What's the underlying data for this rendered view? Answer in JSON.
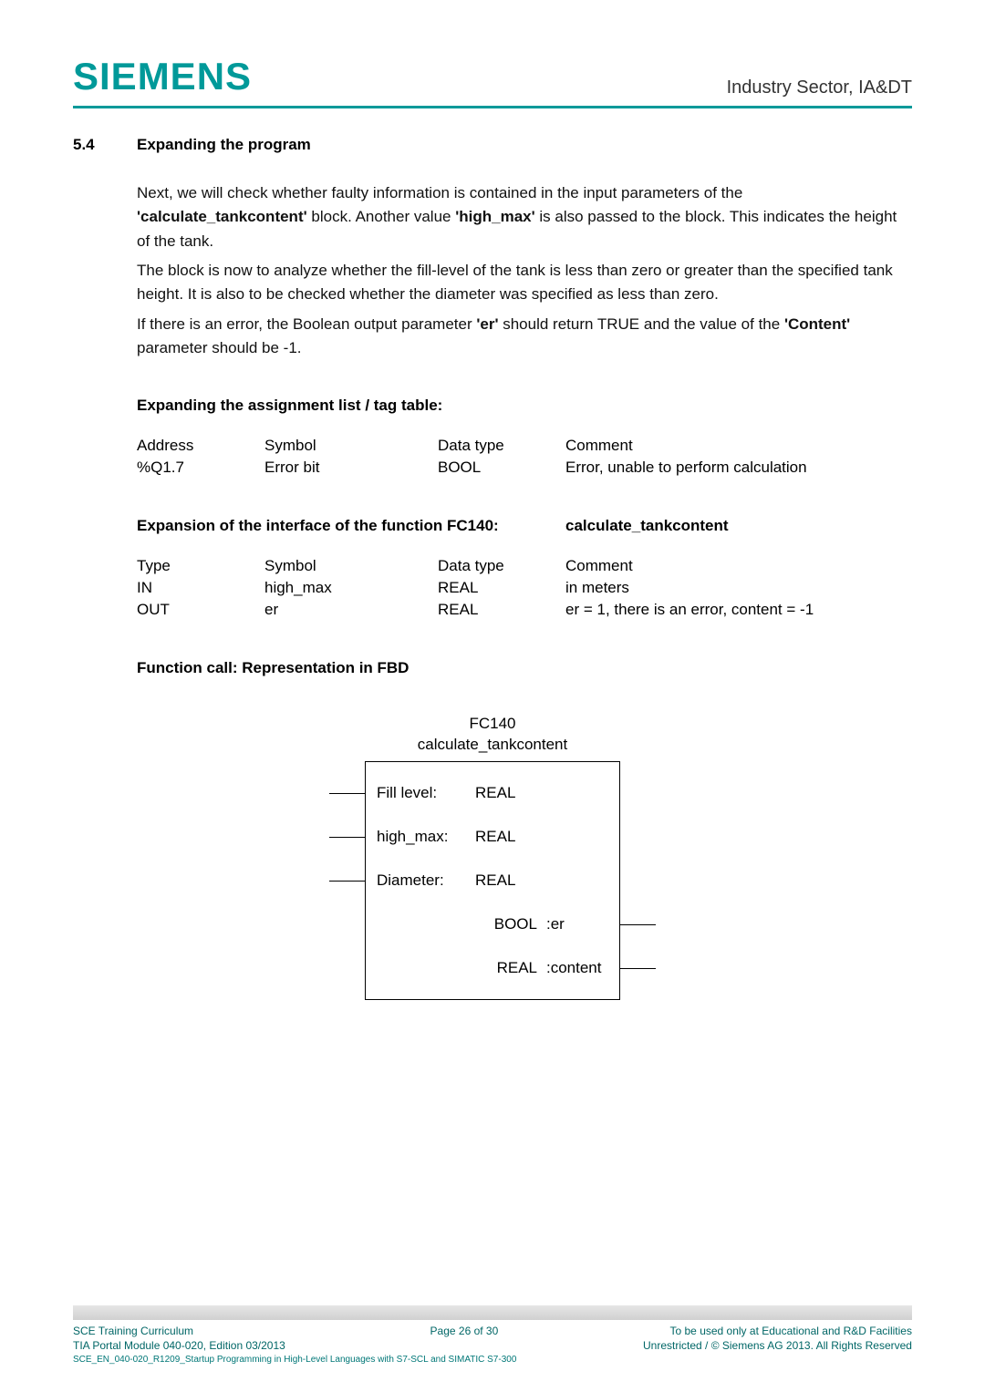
{
  "header": {
    "logo": "SIEMENS",
    "sector": "Industry Sector, IA&DT"
  },
  "section": {
    "number": "5.4",
    "title": "Expanding the program"
  },
  "intro": {
    "p1a": "Next, we will check whether faulty information is contained in the input parameters of the ",
    "p1b": "'calculate_tankcontent'",
    "p1c": " block. Another value ",
    "p1d": "'high_max'",
    "p1e": " is also passed to the block. This indicates the height of the tank.",
    "p2": "The block is now to analyze whether the fill-level of the tank is less than zero or greater than the specified tank height. It is also to be checked whether the diameter was specified as less than zero.",
    "p3a": "If there is an error, the Boolean output parameter ",
    "p3b": "'er'",
    "p3c": " should return TRUE and the value of the ",
    "p3d": "'Content'",
    "p3e": " parameter should be -1."
  },
  "tagtable": {
    "heading": "Expanding the assignment list / tag table:",
    "head": {
      "c1": "Address",
      "c2": "Symbol",
      "c3": "Data type",
      "c4": "Comment"
    },
    "rows": [
      {
        "c1": "%Q1.7",
        "c2": "Error bit",
        "c3": "BOOL",
        "c4": "Error, unable to perform calculation"
      }
    ]
  },
  "expansion": {
    "left": "Expansion of the interface of the function FC140:",
    "right": "calculate_tankcontent",
    "head": {
      "c1": "Type",
      "c2": "Symbol",
      "c3": "Data type",
      "c4": "Comment"
    },
    "rows": [
      {
        "c1": "IN",
        "c2": "high_max",
        "c3": "REAL",
        "c4": "in meters"
      },
      {
        "c1": "OUT",
        "c2": "er",
        "c3": "REAL",
        "c4": "er = 1, there is an error, content = -1"
      }
    ]
  },
  "funccall": "Function call:  Representation in FBD",
  "fbd": {
    "title1": "FC140",
    "title2": "calculate_tankcontent",
    "inputs": [
      {
        "label": "Fill level:",
        "type": "REAL"
      },
      {
        "label": "high_max:",
        "type": "REAL"
      },
      {
        "label": "Diameter:",
        "type": "REAL"
      }
    ],
    "outputs": [
      {
        "type": "BOOL",
        "name": ":er"
      },
      {
        "type": "REAL",
        "name": ":content"
      }
    ]
  },
  "footer": {
    "left1": "SCE Training Curriculum",
    "left2": "TIA Portal Module 040-020, Edition 03/2013",
    "left3": "SCE_EN_040-020_R1209_Startup Programming in High-Level Languages with S7-SCL and SIMATIC S7-300",
    "center": "Page 26 of 30",
    "right1": "To be used only at Educational and R&D Facilities",
    "right2": "Unrestricted / © Siemens AG 2013. All Rights Reserved"
  }
}
